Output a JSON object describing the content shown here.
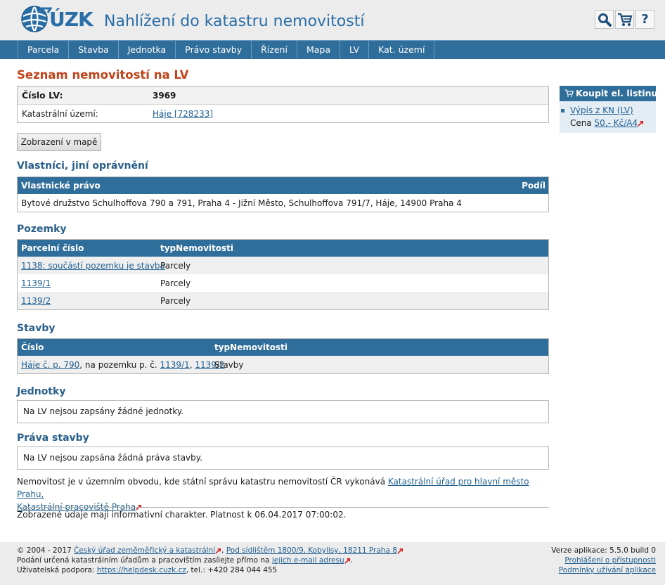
{
  "header": {
    "logo_text": "ÚZK",
    "app_title": "Nahlížení do katastru nemovitostí",
    "icons": [
      "search-icon",
      "cart-icon",
      "help-icon"
    ],
    "help_glyph": "?"
  },
  "nav": {
    "items": [
      "Parcela",
      "Stavba",
      "Jednotka",
      "Právo stavby",
      "Řízení",
      "Mapa",
      "LV",
      "Kat. území"
    ]
  },
  "page": {
    "title": "Seznam nemovitostí na LV"
  },
  "info": {
    "lv_label": "Číslo LV:",
    "lv_value": "3969",
    "ku_label": "Katastrální území:",
    "ku_value": "Háje [728233]"
  },
  "map_button": "Zobrazení v mapě",
  "owners": {
    "title": "Vlastníci, jiní oprávnění",
    "col_right": "Vlastnické právo",
    "col_share": "Podíl",
    "rows": [
      "Bytové družstvo Schulhoffova 790 a 791, Praha 4 - Jižní Město, Schulhoffova 791/7, Háje, 14900 Praha 4"
    ]
  },
  "parcels": {
    "title": "Pozemky",
    "col_number": "Parcelní číslo",
    "col_type": "typNemovitosti",
    "rows": [
      {
        "number": "1138: součástí pozemku je stavba",
        "type": "Parcely"
      },
      {
        "number": "1139/1",
        "type": "Parcely"
      },
      {
        "number": "1139/2",
        "type": "Parcely"
      }
    ]
  },
  "buildings": {
    "title": "Stavby",
    "col_number": "Číslo",
    "col_type": "typNemovitosti",
    "row": {
      "building_link": "Háje č. p. 790",
      "middle_text": ", na pozemku p. č. ",
      "parcel1": "1139/1",
      "comma": ", ",
      "parcel2": "1139/2",
      "type": "Stavby"
    }
  },
  "units": {
    "title": "Jednotky",
    "message": "Na LV nejsou zapsány žádné jednotky."
  },
  "building_rights": {
    "title": "Práva stavby",
    "message": "Na LV nejsou zapsána žádná práva stavby."
  },
  "note": {
    "text": "Nemovitost je v územním obvodu, kde státní správu katastru nemovitostí ČR vykonává ",
    "office_link": "Katastrální úřad pro hlavní město Prahu,",
    "workplace_link": "Katastrální pracoviště Praha"
  },
  "validity": "Zobrazené údaje mají informativní charakter. Platnost k 06.04.2017 07:00:02.",
  "buy": {
    "title": "Koupit el. listinu",
    "item_link": "Výpis z KN (LV)",
    "price_label": "Cena ",
    "price_link": "50,- Kč/A4"
  },
  "footer": {
    "copyright": "© 2004 - 2017 ",
    "org_link": "Český úřad zeměměřický a katastrální",
    "sep": ", ",
    "address_link": "Pod sídlištěm 1800/9, Kobylisy, 18211 Praha 8",
    "submit_text": "Podání určená katastrálním úřadům a pracovištím zasílejte přímo na ",
    "email_link": "jejich e-mail adresu",
    "support_text": "Uživatelská podpora: ",
    "support_link": "https://helpdesk.cuzk.cz",
    "support_tel": ", tel.: +420 284 044 455",
    "version": "Verze aplikace: 5.5.0 build 0",
    "accessibility_link": "Prohlášení o přístupnosti",
    "terms_link": "Podmínky užívání aplikace"
  },
  "colors": {
    "nav_blue": "#2f6d9a",
    "title_orange": "#c0431a",
    "link_blue": "#1f5f91"
  }
}
